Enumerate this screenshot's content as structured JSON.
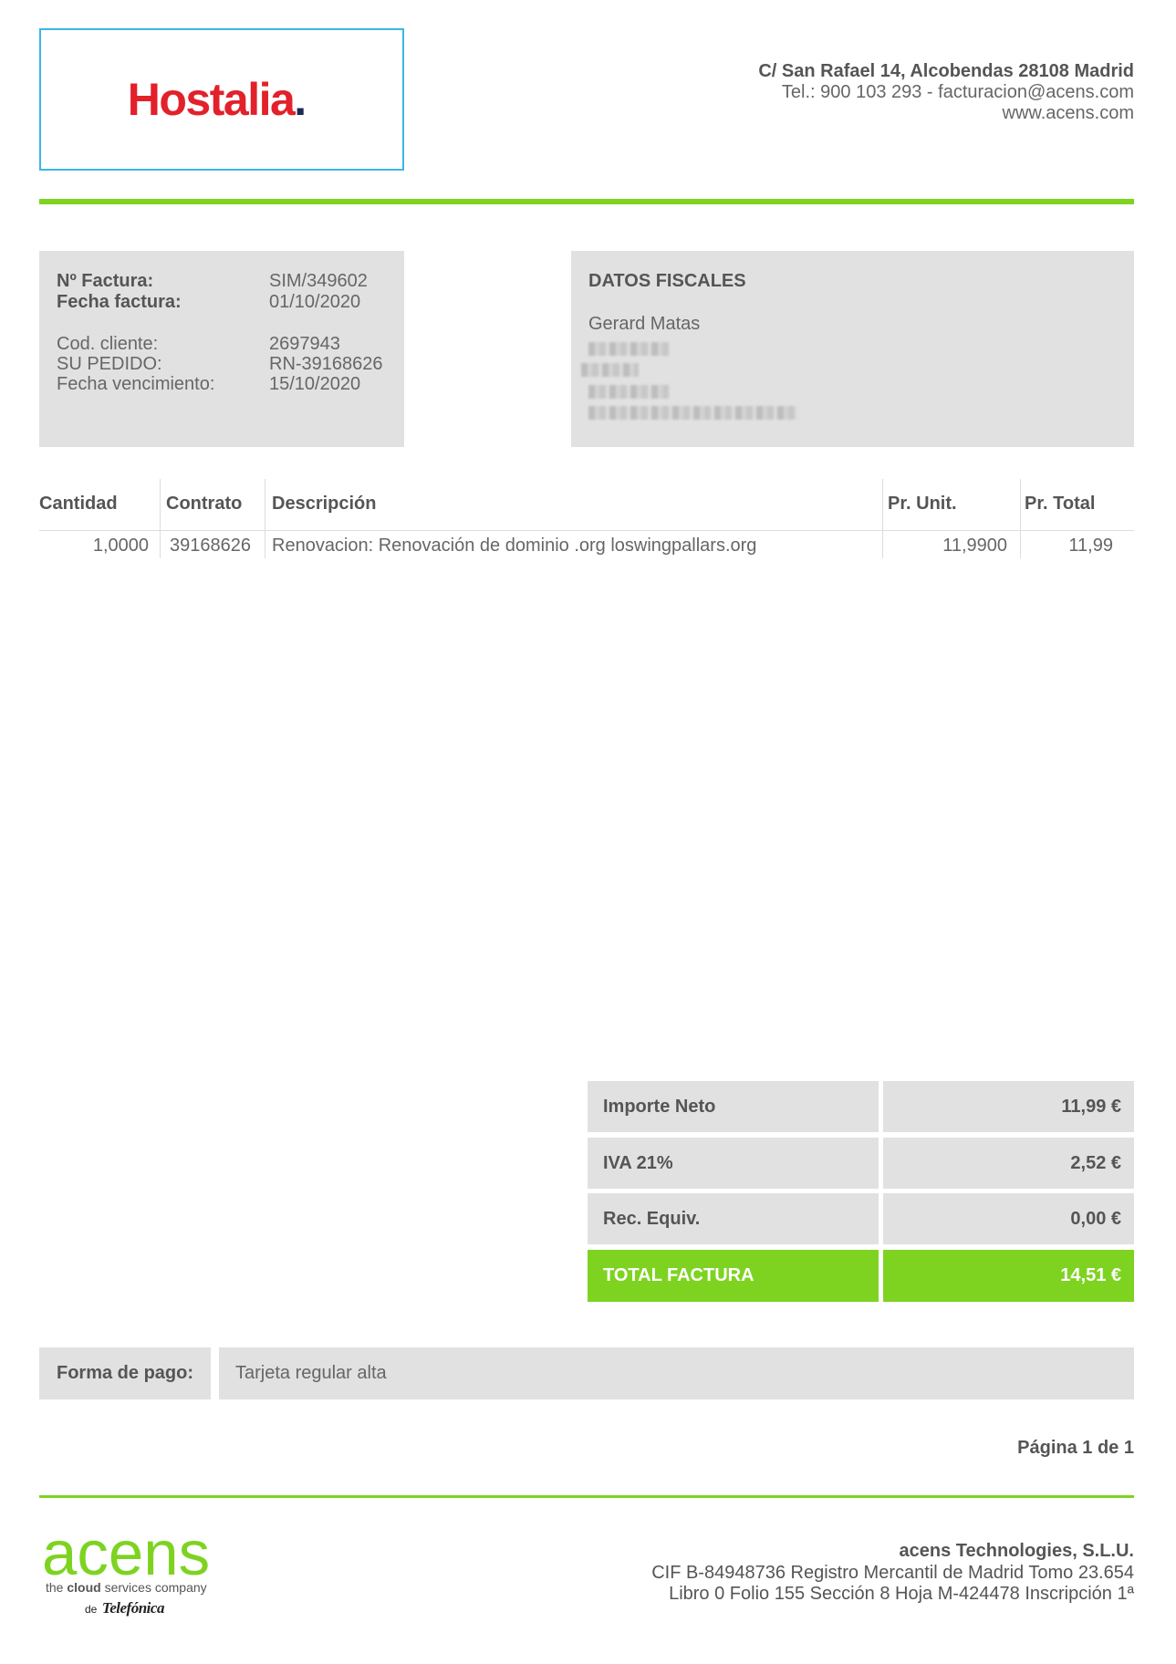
{
  "logo": {
    "name": "Hostalia",
    "dot": "."
  },
  "company_address": {
    "street": "C/ San Rafael 14, Alcobendas 28108 Madrid",
    "contact": "Tel.: 900 103 293 - facturacion@acens.com",
    "website": "www.acens.com"
  },
  "invoice_info": {
    "number_label": "Nº Factura:",
    "number": "SIM/349602",
    "date_label": "Fecha factura:",
    "date": "01/10/2020",
    "client_label": "Cod. cliente:",
    "client": "2697943",
    "order_label": "SU PEDIDO:",
    "order": "RN-39168626",
    "due_label": "Fecha vencimiento:",
    "due": "15/10/2020"
  },
  "fiscal_data": {
    "title": "DATOS FISCALES",
    "name": "Gerard Matas"
  },
  "items_table": {
    "headers": [
      "Cantidad",
      "Contrato",
      "Descripción",
      "Pr. Unit.",
      "Pr. Total"
    ],
    "rows": [
      [
        "1,0000",
        "39168626",
        "Renovacion: Renovación de dominio .org loswingpallars.org",
        "11,9900",
        "11,99"
      ]
    ]
  },
  "totals": [
    {
      "label": "Importe Neto",
      "value": "11,99 €"
    },
    {
      "label": "IVA 21%",
      "value": "2,52 €"
    },
    {
      "label": "Rec. Equiv.",
      "value": "0,00 €"
    },
    {
      "label": "TOTAL FACTURA",
      "value": "14,51 €"
    }
  ],
  "payment": {
    "label": "Forma de pago:",
    "value": "Tarjeta regular alta"
  },
  "page_indicator": "Página 1 de 1",
  "acens_logo": {
    "name": "acens",
    "tagline_start": "the",
    "tagline_bold": "cloud",
    "tagline_end": "services company",
    "by": "de",
    "parent": "Telefónica"
  },
  "footer": {
    "company": "acens Technologies, S.L.U.",
    "registry_line1": "CIF B-84948736 Registro Mercantil de Madrid Tomo 23.654",
    "registry_line2": "Libro 0 Folio 155 Sección 8 Hoja M-424478 Inscripción 1ª"
  },
  "colors": {
    "accent_green": "#7ed321",
    "panel_gray": "#e1e1e1",
    "logo_border": "#3db5e6",
    "brand_red": "#e2212b",
    "brand_navy": "#1b2a55"
  }
}
